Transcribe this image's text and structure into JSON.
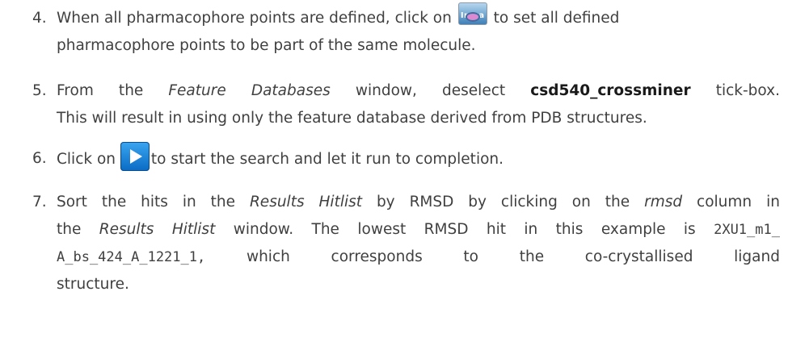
{
  "steps": [
    {
      "number": "4.",
      "line1_pre": "When all pharmacophore points are defined, click on",
      "line1_post": "to set all defined",
      "line2": "pharmacophore points to be part of the same molecule.",
      "icon": "intra-icon",
      "icon_label": "Intra"
    },
    {
      "number": "5.",
      "l1_a": "From the",
      "l1_em": "Feature Databases",
      "l1_b": "window, deselect",
      "l1_bold": "csd540_crossminer",
      "l1_c": "tick-box.",
      "line2": "This will result in using only the feature database derived from PDB structures."
    },
    {
      "number": "6.",
      "pre": "Click on",
      "post": "to start the search and let it run to completion.",
      "icon": "play-icon"
    },
    {
      "number": "7.",
      "l1_a": "Sort the hits in the",
      "l1_em1": "Results Hitlist",
      "l1_b": "by RMSD by clicking on the",
      "l1_em2": "rmsd",
      "l1_c": "column in",
      "l2_a": "the",
      "l2_em": "Results Hitlist",
      "l2_b": "window.  The lowest RMSD hit in this example is",
      "l2_code": "2XU1_m1_",
      "l3_code": "A_bs_424_A_1221_1,",
      "l3_b": "which corresponds to the co-crystallised ligand",
      "line4": "structure."
    }
  ]
}
